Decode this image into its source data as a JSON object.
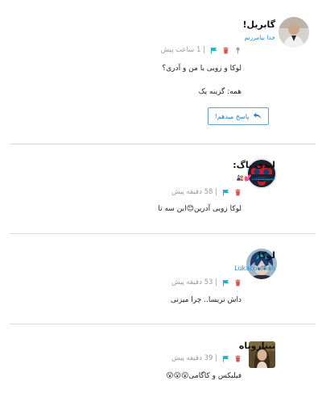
{
  "comments": [
    {
      "name": "گابریل!",
      "subtitle": "خدا بیامرزتم",
      "time": "| 1 ساعت پیش",
      "lines": [
        "لوکا و زویی یا من و آدری؟",
        "همه: گزینه یک"
      ],
      "reply_label": "پاسخ میدهم!"
    },
    {
      "name": "لیدی باگ:",
      "subtitle": "سییتتتتتت💕🎎",
      "time": "| 58 دقیقه پیش",
      "lines": [
        "لوکا زویی آدرین😊این سه تا"
      ]
    },
    {
      "name": "لوکا",
      "subtitle": "Lukacouffian",
      "time": "| 53 دقیقه پیش",
      "lines": [
        "داش تریسا.. چرا میزنی"
      ]
    },
    {
      "name": "تینارویاه",
      "subtitle": "",
      "time": "| 39 دقیقه پیش",
      "lines": [
        "فیلیکس و کاگامی😮😮😮"
      ]
    }
  ],
  "colors": {
    "flag": "#22b3c7",
    "trash": "#d9534f",
    "pin": "#a0a0a0",
    "link": "#2a8bd0",
    "divider": "#d9d9d9"
  }
}
